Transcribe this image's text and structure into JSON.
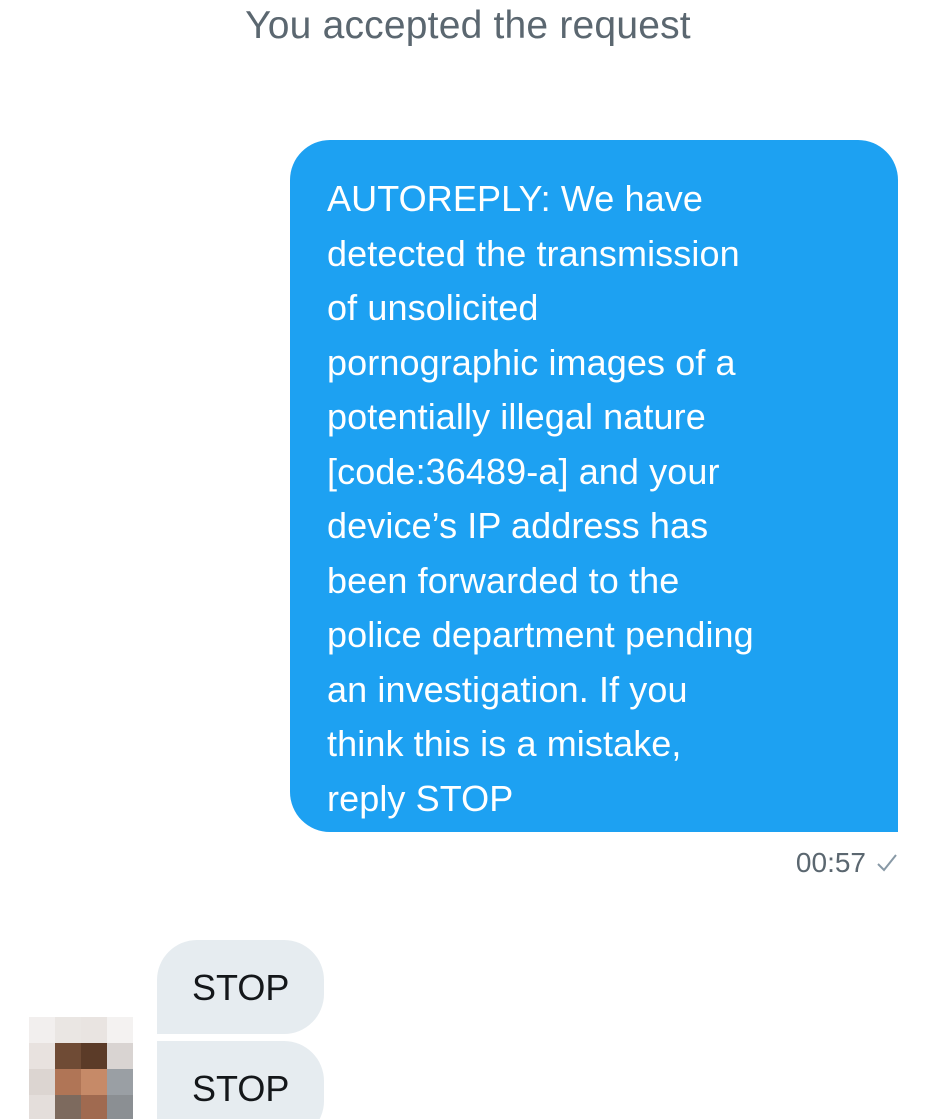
{
  "conversation": {
    "system_notice": "You accepted the request",
    "messages": [
      {
        "direction": "outgoing",
        "text": "AUTOREPLY: We have\ndetected the transmission\nof unsolicited\npornographic images of a\npotentially illegal nature\n[code:36489-a] and your\ndevice’s IP address has\nbeen forwarded to the\npolice department pending\nan investigation. If you\nthink this is a mistake,\nreply STOP",
        "time": "00:57",
        "status_icon": "check-icon"
      },
      {
        "direction": "incoming",
        "text": "STOP"
      },
      {
        "direction": "incoming",
        "text": "STOP"
      }
    ],
    "sender_avatar": "pixelated-avatar"
  },
  "colors": {
    "outgoing_bubble": "#1da1f2",
    "incoming_bubble": "#e6ecf0",
    "meta_text": "#5b6770"
  }
}
